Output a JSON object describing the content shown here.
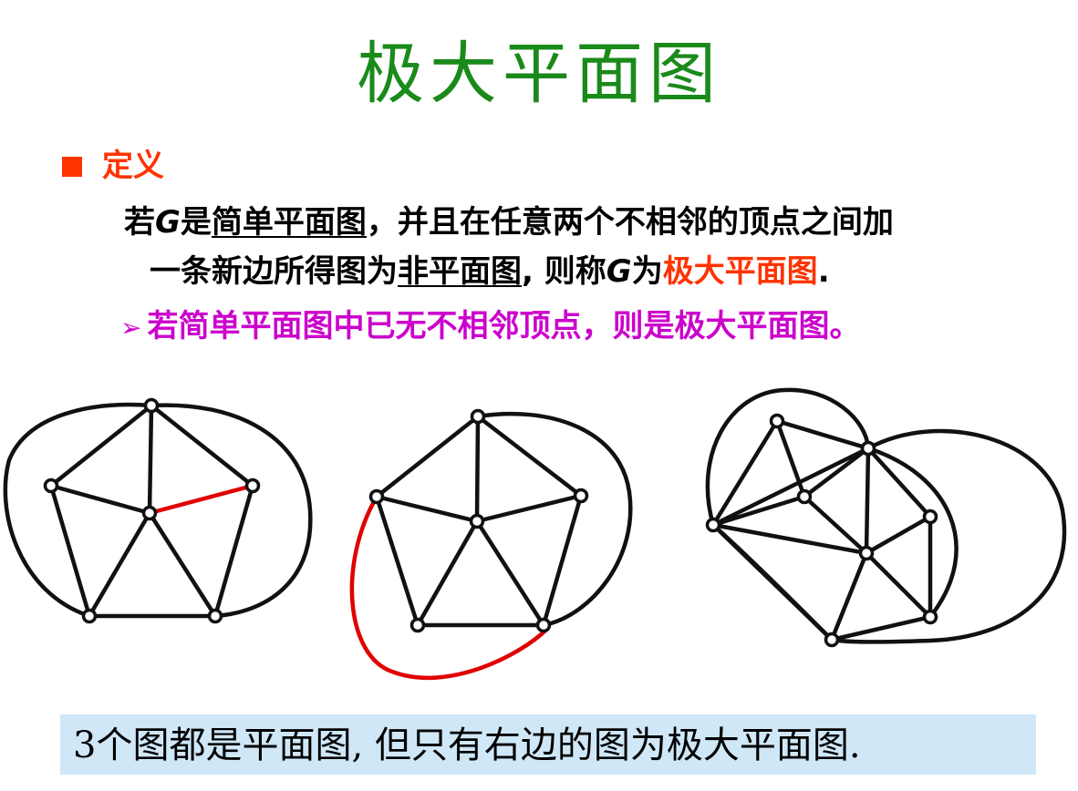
{
  "title": "极大平面图",
  "definition": {
    "heading": "定义",
    "line1": {
      "p1": "若",
      "g1": "G",
      "p2": "是",
      "u1": "简单平面图",
      "p3": "，并且在任意两个不相邻的顶点之间加"
    },
    "line2": {
      "p1": "一条新边所得图为",
      "u1": "非平面图",
      "p2": ", 则称",
      "g1": "G",
      "p3": "为",
      "h1": "极大平面图",
      "p4": "."
    }
  },
  "note": {
    "arrow": "➢",
    "text": "若简单平面图中已无不相邻顶点，则是极大平面图。"
  },
  "caption": "3个图都是平面图, 但只有右边的图为极大平面图.",
  "colors": {
    "title": "#1a8a1a",
    "accent": "#ff3300",
    "note": "#cc00cc",
    "new_edge": "#e00000",
    "caption_bg": "#cfe7f7"
  }
}
